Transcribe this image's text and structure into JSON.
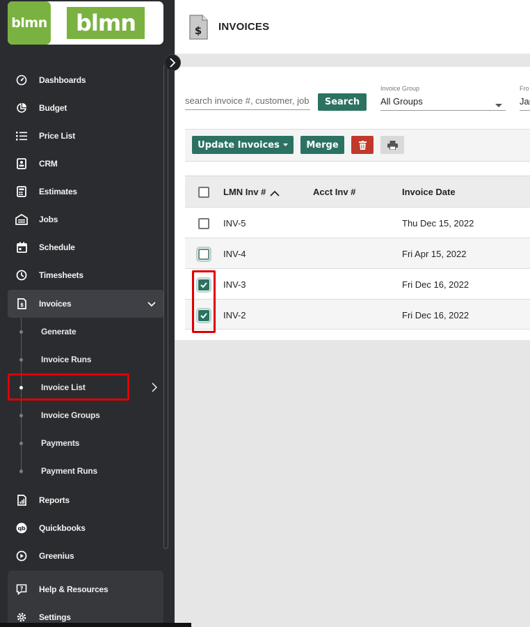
{
  "sidebar": {
    "logo_small": "blmn",
    "logo_large": "blmn",
    "items": [
      {
        "label": "Dashboards",
        "icon": "speedometer-icon"
      },
      {
        "label": "Budget",
        "icon": "pie-chart-icon"
      },
      {
        "label": "Price List",
        "icon": "list-icon"
      },
      {
        "label": "CRM",
        "icon": "contact-card-icon"
      },
      {
        "label": "Estimates",
        "icon": "calculator-icon"
      },
      {
        "label": "Jobs",
        "icon": "garage-icon"
      },
      {
        "label": "Schedule",
        "icon": "calendar-icon"
      },
      {
        "label": "Timesheets",
        "icon": "clock-icon"
      },
      {
        "label": "Invoices",
        "icon": "invoice-icon"
      }
    ],
    "invoices_subitems": [
      {
        "label": "Generate"
      },
      {
        "label": "Invoice Runs"
      },
      {
        "label": "Invoice List"
      },
      {
        "label": "Invoice Groups"
      },
      {
        "label": "Payments"
      },
      {
        "label": "Payment Runs"
      }
    ],
    "lower_items": [
      {
        "label": "Reports",
        "icon": "report-icon"
      },
      {
        "label": "Quickbooks",
        "icon": "quickbooks-icon"
      },
      {
        "label": "Greenius",
        "icon": "play-circle-icon"
      }
    ],
    "help": {
      "label": "Help & Resources"
    },
    "settings": {
      "label": "Settings"
    }
  },
  "header": {
    "title": "INVOICES"
  },
  "filters": {
    "search_placeholder": "search invoice #, customer, job",
    "search_button": "Search",
    "invoice_group_label": "Invoice Group",
    "invoice_group_value": "All Groups",
    "from_label": "Fro",
    "from_value": "Jan"
  },
  "toolbar": {
    "update_label": "Update Invoices",
    "merge_label": "Merge"
  },
  "table": {
    "columns": [
      "LMN Inv #",
      "Acct Inv #",
      "Invoice Date"
    ],
    "rows": [
      {
        "lmn": "INV-5",
        "acct": "",
        "date": "Thu Dec 15, 2022",
        "checked": false
      },
      {
        "lmn": "INV-4",
        "acct": "",
        "date": "Fri Apr 15, 2022",
        "checked": false
      },
      {
        "lmn": "INV-3",
        "acct": "",
        "date": "Fri Dec 16, 2022",
        "checked": true
      },
      {
        "lmn": "INV-2",
        "acct": "",
        "date": "Fri Dec 16, 2022",
        "checked": true
      }
    ]
  },
  "colors": {
    "sidebar_bg": "#2b2c30",
    "brand_green": "#7ab241",
    "primary_button": "#2b7262",
    "danger_button": "#c0392b",
    "highlight": "#e00000"
  }
}
